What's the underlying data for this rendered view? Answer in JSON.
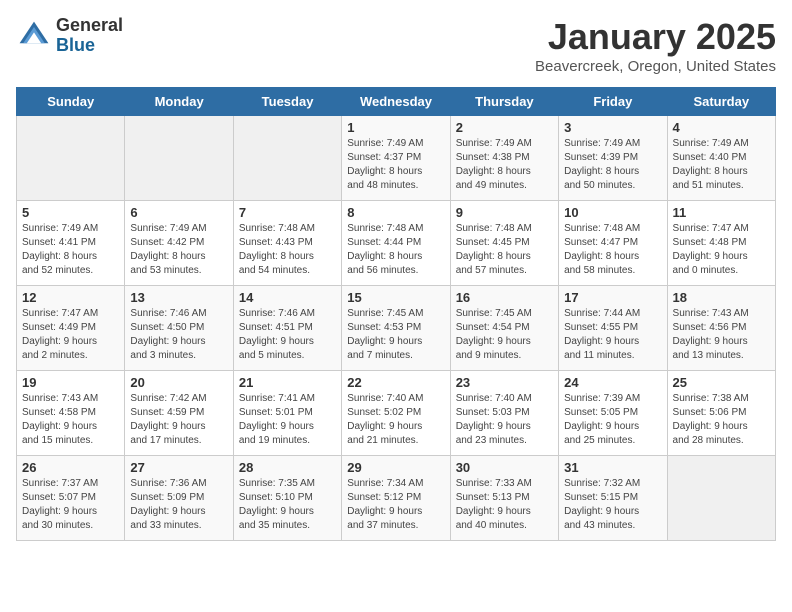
{
  "logo": {
    "general": "General",
    "blue": "Blue"
  },
  "title": "January 2025",
  "subtitle": "Beavercreek, Oregon, United States",
  "days_of_week": [
    "Sunday",
    "Monday",
    "Tuesday",
    "Wednesday",
    "Thursday",
    "Friday",
    "Saturday"
  ],
  "weeks": [
    [
      {
        "day": "",
        "info": ""
      },
      {
        "day": "",
        "info": ""
      },
      {
        "day": "",
        "info": ""
      },
      {
        "day": "1",
        "info": "Sunrise: 7:49 AM\nSunset: 4:37 PM\nDaylight: 8 hours\nand 48 minutes."
      },
      {
        "day": "2",
        "info": "Sunrise: 7:49 AM\nSunset: 4:38 PM\nDaylight: 8 hours\nand 49 minutes."
      },
      {
        "day": "3",
        "info": "Sunrise: 7:49 AM\nSunset: 4:39 PM\nDaylight: 8 hours\nand 50 minutes."
      },
      {
        "day": "4",
        "info": "Sunrise: 7:49 AM\nSunset: 4:40 PM\nDaylight: 8 hours\nand 51 minutes."
      }
    ],
    [
      {
        "day": "5",
        "info": "Sunrise: 7:49 AM\nSunset: 4:41 PM\nDaylight: 8 hours\nand 52 minutes."
      },
      {
        "day": "6",
        "info": "Sunrise: 7:49 AM\nSunset: 4:42 PM\nDaylight: 8 hours\nand 53 minutes."
      },
      {
        "day": "7",
        "info": "Sunrise: 7:48 AM\nSunset: 4:43 PM\nDaylight: 8 hours\nand 54 minutes."
      },
      {
        "day": "8",
        "info": "Sunrise: 7:48 AM\nSunset: 4:44 PM\nDaylight: 8 hours\nand 56 minutes."
      },
      {
        "day": "9",
        "info": "Sunrise: 7:48 AM\nSunset: 4:45 PM\nDaylight: 8 hours\nand 57 minutes."
      },
      {
        "day": "10",
        "info": "Sunrise: 7:48 AM\nSunset: 4:47 PM\nDaylight: 8 hours\nand 58 minutes."
      },
      {
        "day": "11",
        "info": "Sunrise: 7:47 AM\nSunset: 4:48 PM\nDaylight: 9 hours\nand 0 minutes."
      }
    ],
    [
      {
        "day": "12",
        "info": "Sunrise: 7:47 AM\nSunset: 4:49 PM\nDaylight: 9 hours\nand 2 minutes."
      },
      {
        "day": "13",
        "info": "Sunrise: 7:46 AM\nSunset: 4:50 PM\nDaylight: 9 hours\nand 3 minutes."
      },
      {
        "day": "14",
        "info": "Sunrise: 7:46 AM\nSunset: 4:51 PM\nDaylight: 9 hours\nand 5 minutes."
      },
      {
        "day": "15",
        "info": "Sunrise: 7:45 AM\nSunset: 4:53 PM\nDaylight: 9 hours\nand 7 minutes."
      },
      {
        "day": "16",
        "info": "Sunrise: 7:45 AM\nSunset: 4:54 PM\nDaylight: 9 hours\nand 9 minutes."
      },
      {
        "day": "17",
        "info": "Sunrise: 7:44 AM\nSunset: 4:55 PM\nDaylight: 9 hours\nand 11 minutes."
      },
      {
        "day": "18",
        "info": "Sunrise: 7:43 AM\nSunset: 4:56 PM\nDaylight: 9 hours\nand 13 minutes."
      }
    ],
    [
      {
        "day": "19",
        "info": "Sunrise: 7:43 AM\nSunset: 4:58 PM\nDaylight: 9 hours\nand 15 minutes."
      },
      {
        "day": "20",
        "info": "Sunrise: 7:42 AM\nSunset: 4:59 PM\nDaylight: 9 hours\nand 17 minutes."
      },
      {
        "day": "21",
        "info": "Sunrise: 7:41 AM\nSunset: 5:01 PM\nDaylight: 9 hours\nand 19 minutes."
      },
      {
        "day": "22",
        "info": "Sunrise: 7:40 AM\nSunset: 5:02 PM\nDaylight: 9 hours\nand 21 minutes."
      },
      {
        "day": "23",
        "info": "Sunrise: 7:40 AM\nSunset: 5:03 PM\nDaylight: 9 hours\nand 23 minutes."
      },
      {
        "day": "24",
        "info": "Sunrise: 7:39 AM\nSunset: 5:05 PM\nDaylight: 9 hours\nand 25 minutes."
      },
      {
        "day": "25",
        "info": "Sunrise: 7:38 AM\nSunset: 5:06 PM\nDaylight: 9 hours\nand 28 minutes."
      }
    ],
    [
      {
        "day": "26",
        "info": "Sunrise: 7:37 AM\nSunset: 5:07 PM\nDaylight: 9 hours\nand 30 minutes."
      },
      {
        "day": "27",
        "info": "Sunrise: 7:36 AM\nSunset: 5:09 PM\nDaylight: 9 hours\nand 33 minutes."
      },
      {
        "day": "28",
        "info": "Sunrise: 7:35 AM\nSunset: 5:10 PM\nDaylight: 9 hours\nand 35 minutes."
      },
      {
        "day": "29",
        "info": "Sunrise: 7:34 AM\nSunset: 5:12 PM\nDaylight: 9 hours\nand 37 minutes."
      },
      {
        "day": "30",
        "info": "Sunrise: 7:33 AM\nSunset: 5:13 PM\nDaylight: 9 hours\nand 40 minutes."
      },
      {
        "day": "31",
        "info": "Sunrise: 7:32 AM\nSunset: 5:15 PM\nDaylight: 9 hours\nand 43 minutes."
      },
      {
        "day": "",
        "info": ""
      }
    ]
  ]
}
